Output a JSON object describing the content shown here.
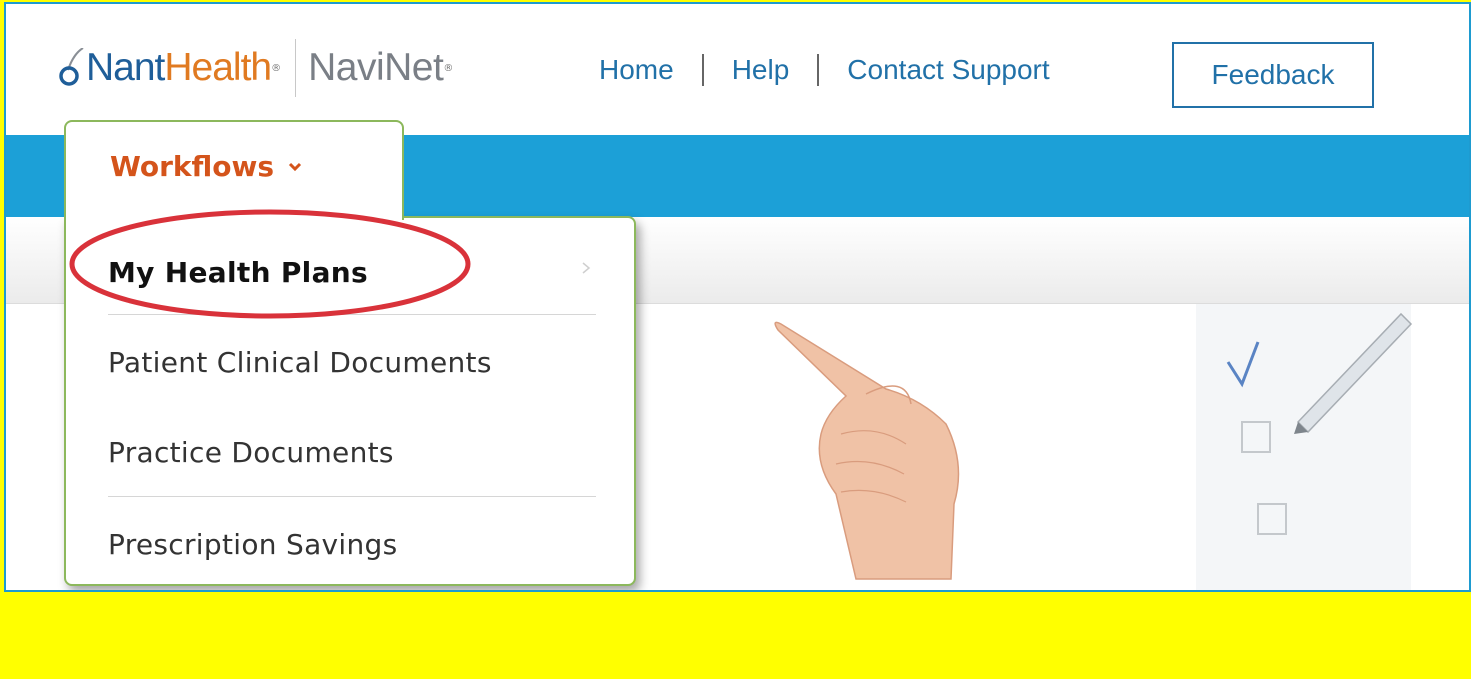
{
  "brand": {
    "nant": "Nant",
    "health": "Health",
    "navinet": "NaviNet",
    "reg_mark": "®"
  },
  "top_nav": {
    "home": "Home",
    "help": "Help",
    "contact": "Contact Support",
    "feedback": "Feedback"
  },
  "main_nav": {
    "workflows_label": "Workflows"
  },
  "workflows_menu": {
    "items": [
      {
        "label": "My Health Plans",
        "has_submenu": true,
        "highlighted": true
      },
      {
        "label": "Patient Clinical Documents",
        "has_submenu": false
      },
      {
        "label": "Practice Documents",
        "has_submenu": false
      },
      {
        "label": "Prescription Savings",
        "has_submenu": false
      }
    ]
  },
  "colors": {
    "accent_blue": "#1ca0d7",
    "link_blue": "#2171a8",
    "workflows_orange": "#d4541b",
    "menu_border_green": "#8cb85c",
    "highlight_red": "#d9323a",
    "background_yellow": "#ffff00"
  },
  "icons": {
    "chevron": "chevron-down-icon",
    "submenu_arrow": "chevron-right-icon",
    "logo": "nanthealth-logo-icon"
  }
}
